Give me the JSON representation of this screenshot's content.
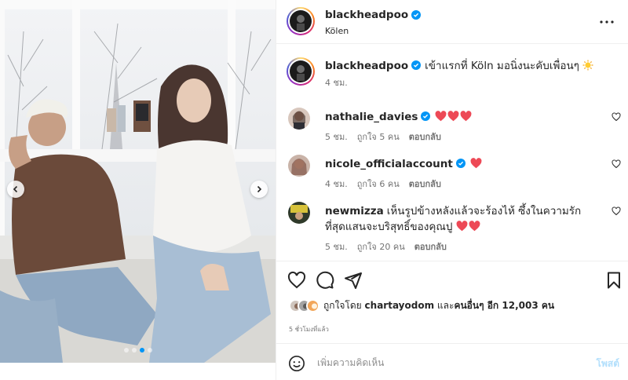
{
  "post": {
    "username": "blackheadpoo",
    "location": "Kölen",
    "caption": "เข้าแรกที่ Köln มอนิ่งนะคับเพื่อนๆ",
    "caption_time": "4 ชม.",
    "photo_index": 3,
    "photo_count": 4
  },
  "comments": [
    {
      "username": "nathalie_davies",
      "text": "",
      "hearts": 3,
      "time": "5 ชม.",
      "likes": "ถูกใจ 5 คน",
      "reply": "ตอบกลับ",
      "verified": true
    },
    {
      "username": "nicole_officialaccount",
      "text": "",
      "hearts": 1,
      "time": "4 ชม.",
      "likes": "ถูกใจ 6 คน",
      "reply": "ตอบกลับ",
      "verified": true
    },
    {
      "username": "newmizza",
      "text": "เห็นรูปข้างหลังแล้วจะร้องไห้ ซึ้งในความรักที่สุดแสนจะบริสุทธิ์ของคุณปู",
      "hearts": 2,
      "time": "5 ชม.",
      "likes": "ถูกใจ 20 คน",
      "reply": "ตอบกลับ",
      "verified": false
    }
  ],
  "likes": {
    "prefix": "ถูกใจโดย",
    "user": "chartayodom",
    "middle": "และ",
    "others": "คนอื่นๆ อีก 12,003 คน"
  },
  "timestamp": "5 ชั่วโมงที่แล้ว",
  "comment_box": {
    "placeholder": "เพิ่มความคิดเห็น",
    "post_label": "โพสต์"
  },
  "icons": {
    "verified": "verified-badge-icon",
    "more": "more-horizontal-icon",
    "like": "heart-icon",
    "comment": "comment-bubble-icon",
    "share": "paper-plane-icon",
    "save": "bookmark-icon",
    "emoji": "smiley-icon"
  },
  "colors": {
    "verified": "#0095f6",
    "heart": "#ed4956",
    "post_disabled": "#b2dffc",
    "muted": "#737373"
  }
}
